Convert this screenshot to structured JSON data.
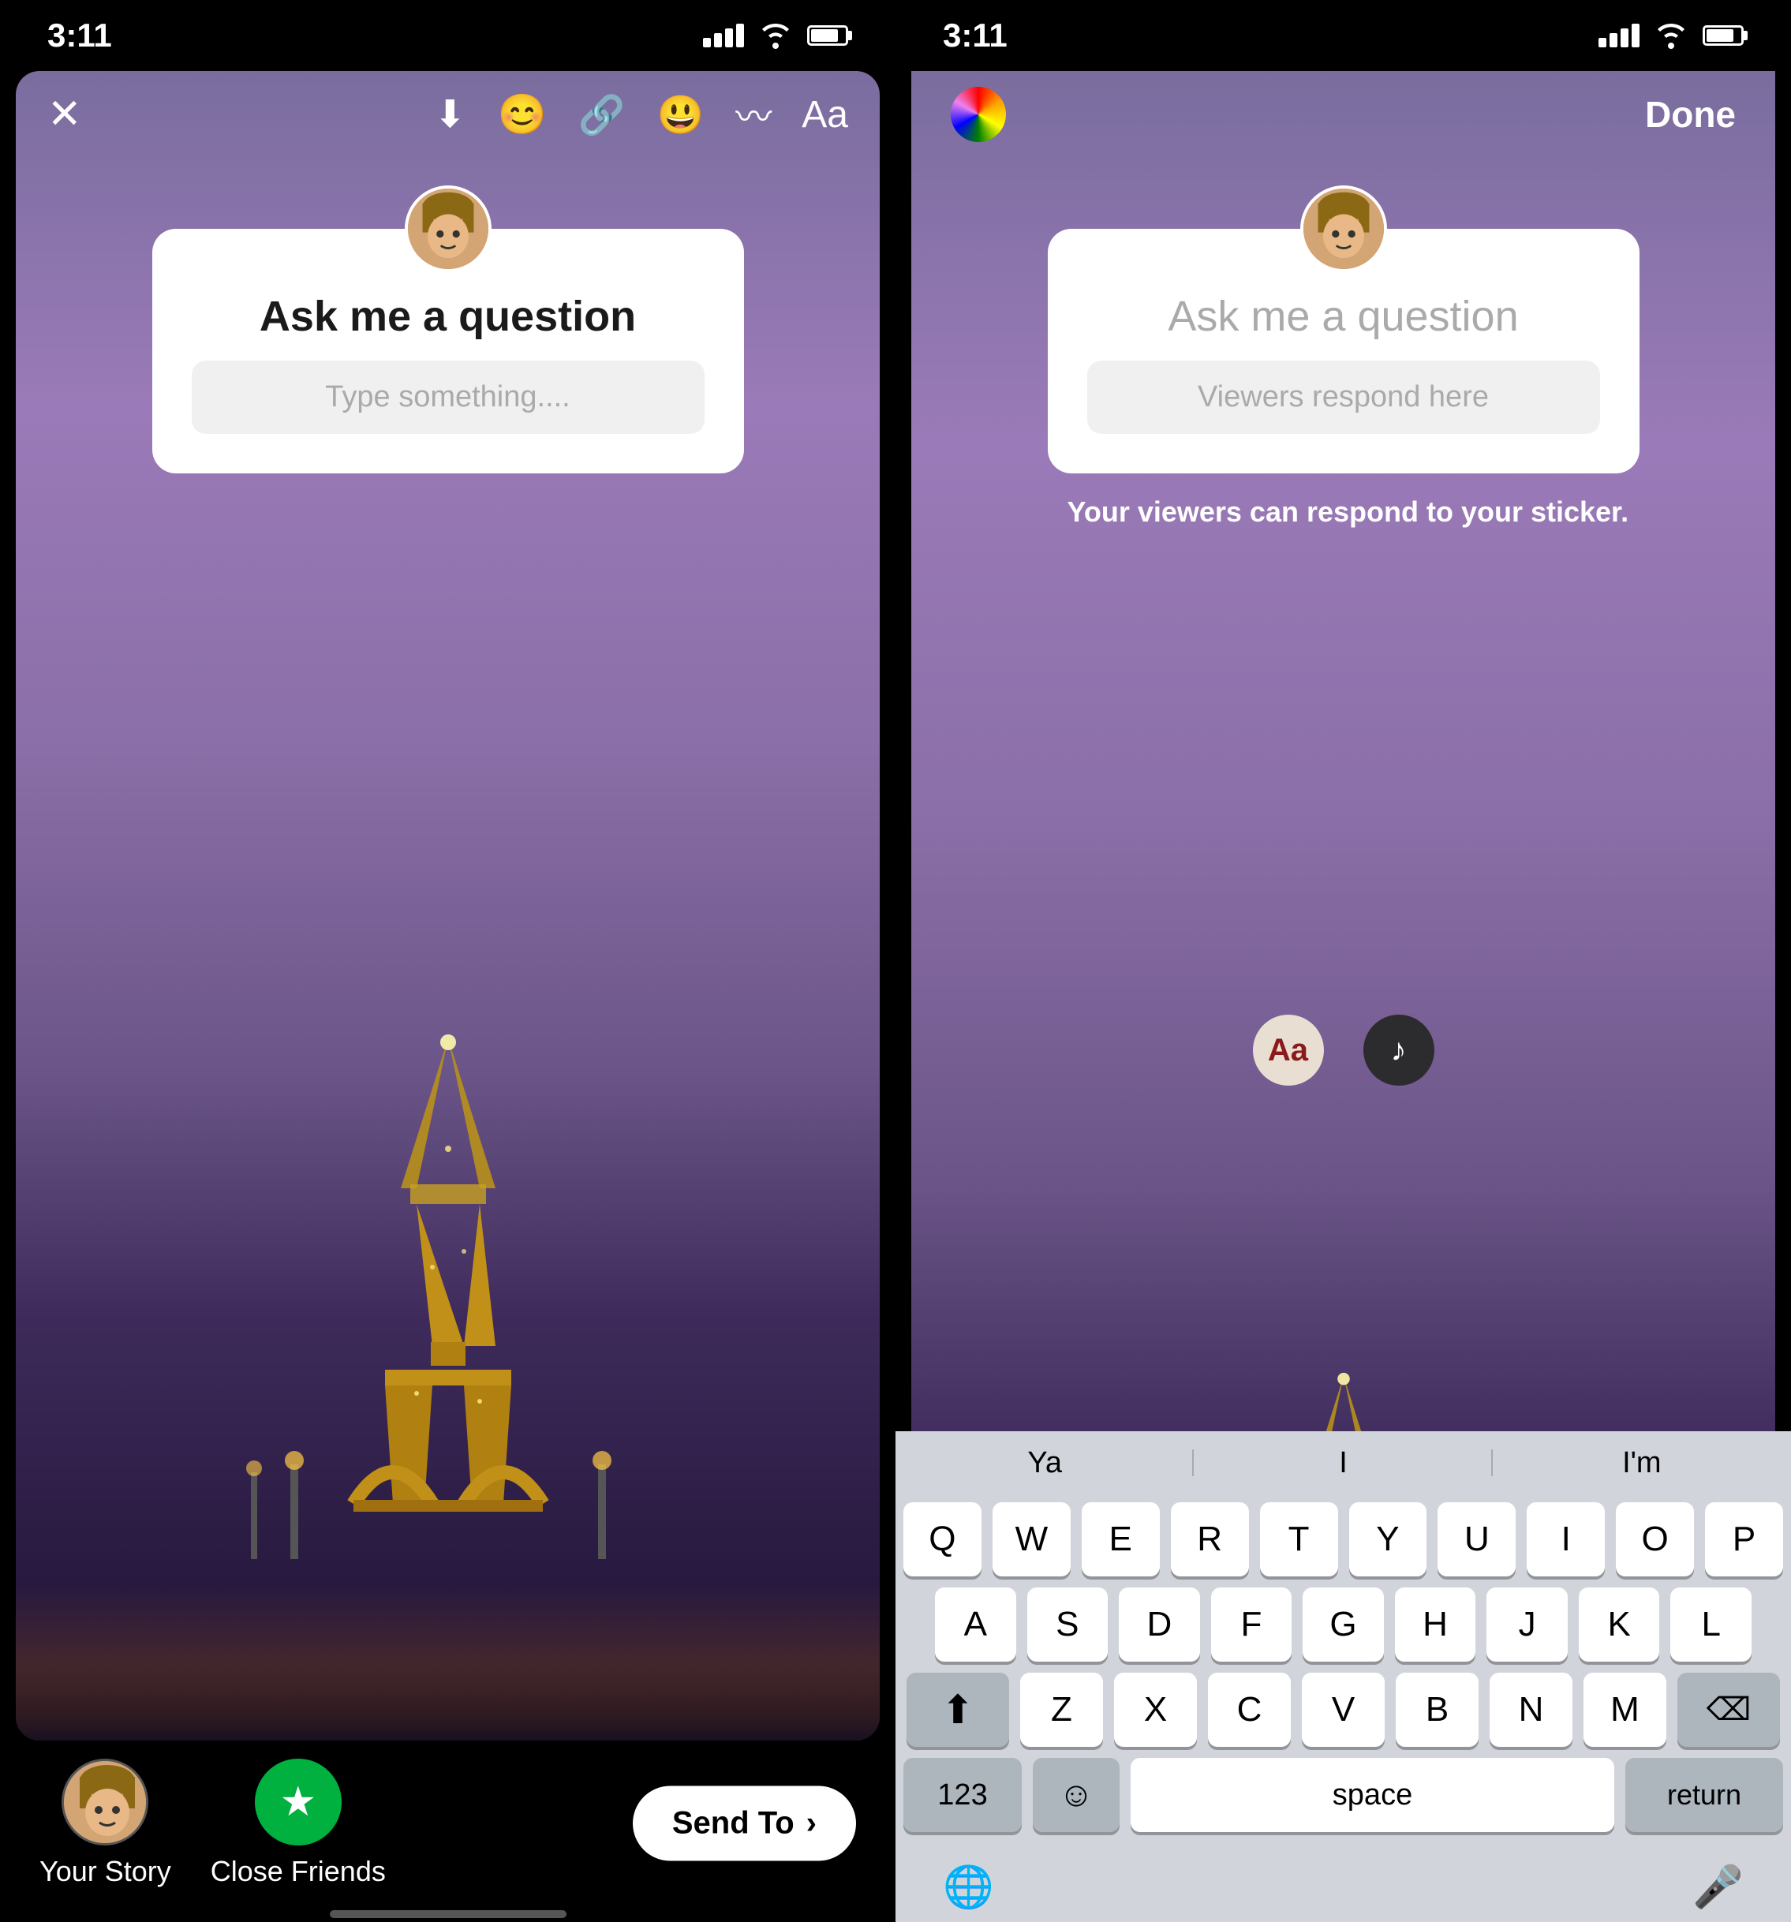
{
  "left": {
    "status_time": "3:11",
    "toolbar_icons": [
      "close",
      "download",
      "emoji-plus",
      "link",
      "sticker",
      "squiggle",
      "text"
    ],
    "sticker": {
      "title": "Ask me a question",
      "input_placeholder": "Type something...."
    },
    "bottom": {
      "your_story_label": "Your Story",
      "close_friends_label": "Close Friends",
      "send_to_label": "Send To",
      "send_arrow": "›"
    }
  },
  "right": {
    "status_time": "3:11",
    "done_label": "Done",
    "sticker": {
      "title": "Ask me a question",
      "input_placeholder": "Viewers respond here",
      "viewer_note": "Your viewers can respond to your sticker."
    },
    "keyboard_toolbar": {
      "aa_label": "Aa",
      "music_label": "♪"
    },
    "predictive": {
      "word1": "Ya",
      "word2": "I",
      "word3": "I'm"
    },
    "keys_row1": [
      "Q",
      "W",
      "E",
      "R",
      "T",
      "Y",
      "U",
      "I",
      "O",
      "P"
    ],
    "keys_row2": [
      "A",
      "S",
      "D",
      "F",
      "G",
      "H",
      "J",
      "K",
      "L"
    ],
    "keys_row3": [
      "Z",
      "X",
      "C",
      "V",
      "B",
      "N",
      "M"
    ],
    "bottom_row": {
      "num_key": "123",
      "emoji_key": "☺",
      "space_key": "space",
      "return_key": "return"
    }
  }
}
